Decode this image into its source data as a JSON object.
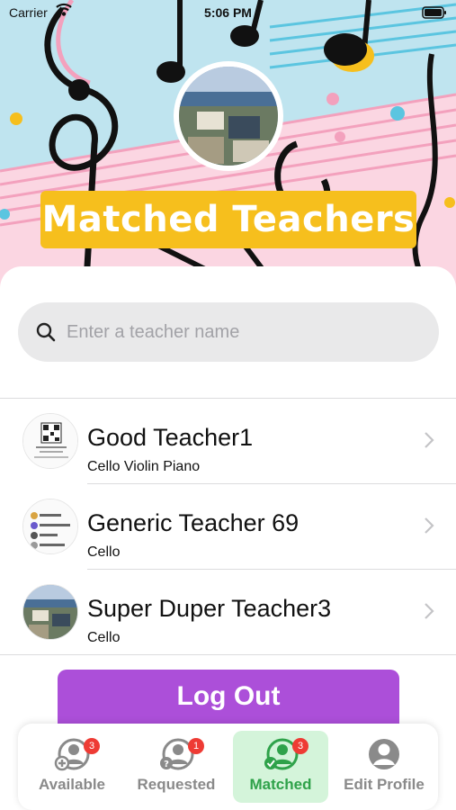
{
  "status_bar": {
    "carrier": "Carrier",
    "time": "5:06 PM"
  },
  "header": {
    "title": "Matched Teachers"
  },
  "search": {
    "placeholder": "Enter a teacher name",
    "value": ""
  },
  "teachers": [
    {
      "name": "Good Teacher1",
      "instruments": "Cello Violin Piano"
    },
    {
      "name": "Generic Teacher 69",
      "instruments": "Cello"
    },
    {
      "name": "Super Duper Teacher3",
      "instruments": "Cello"
    }
  ],
  "actions": {
    "logout_label": "Log Out"
  },
  "tabs": [
    {
      "label": "Available",
      "badge": "3",
      "icon": "add-user-icon"
    },
    {
      "label": "Requested",
      "badge": "1",
      "icon": "question-user-icon"
    },
    {
      "label": "Matched",
      "badge": "3",
      "icon": "check-user-icon"
    },
    {
      "label": "Edit Profile",
      "badge": "",
      "icon": "profile-icon"
    }
  ],
  "colors": {
    "accent_purple": "#ac4fd9",
    "title_bg": "#f6bf1d",
    "active_tab_bg": "#d4f4da",
    "active_tab_text": "#2fa24a",
    "badge": "#ee3b34"
  }
}
